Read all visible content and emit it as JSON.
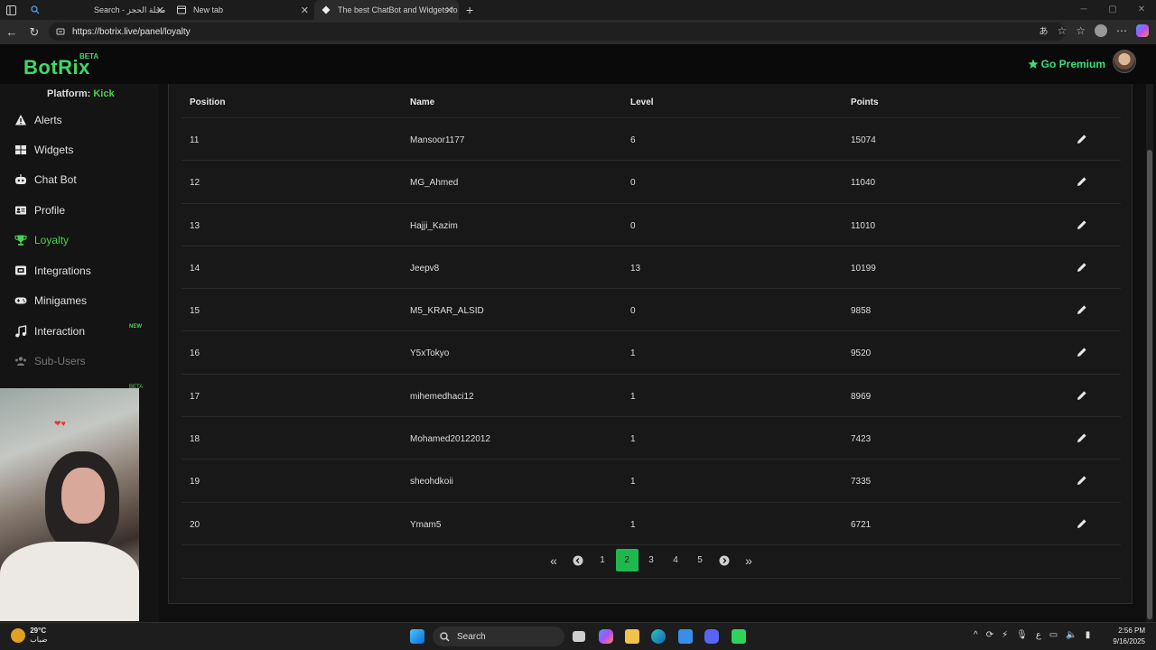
{
  "browser": {
    "tabs": [
      {
        "label": "Search - مجلة الحجز",
        "active": false
      },
      {
        "label": "New tab",
        "active": false
      },
      {
        "label": "The best ChatBot and Widgets fo",
        "active": true
      }
    ],
    "url": "https://botrix.live/panel/loyalty"
  },
  "app": {
    "logo": "BotRix",
    "logo_badge": "BETA",
    "premium_label": "Go Premium"
  },
  "sidebar": {
    "platform_label": "Platform:",
    "platform_value": "Kick",
    "items": [
      {
        "label": "Alerts",
        "icon": "warning-icon"
      },
      {
        "label": "Widgets",
        "icon": "grid-icon"
      },
      {
        "label": "Chat Bot",
        "icon": "robot-icon"
      },
      {
        "label": "Profile",
        "icon": "id-card-icon"
      },
      {
        "label": "Loyalty",
        "icon": "trophy-icon",
        "active": true
      },
      {
        "label": "Integrations",
        "icon": "integrations-icon"
      },
      {
        "label": "Minigames",
        "icon": "gamepad-icon"
      },
      {
        "label": "Interaction",
        "icon": "music-icon",
        "badge": "NEW"
      },
      {
        "label": "Sub-Users",
        "icon": "users-icon",
        "muted": true
      }
    ],
    "hidden_badge": "BETA"
  },
  "table": {
    "headers": {
      "position": "Position",
      "name": "Name",
      "level": "Level",
      "points": "Points"
    },
    "rows": [
      {
        "position": "11",
        "name": "Mansoor1177",
        "level": "6",
        "points": "15074"
      },
      {
        "position": "12",
        "name": "MG_Ahmed",
        "level": "0",
        "points": "11040"
      },
      {
        "position": "13",
        "name": "Hajji_Kazim",
        "level": "0",
        "points": "11010"
      },
      {
        "position": "14",
        "name": "Jeepv8",
        "level": "13",
        "points": "10199"
      },
      {
        "position": "15",
        "name": "M5_KRAR_ALSID",
        "level": "0",
        "points": "9858"
      },
      {
        "position": "16",
        "name": "Y5xTokyo",
        "level": "1",
        "points": "9520"
      },
      {
        "position": "17",
        "name": "mihemedhaci12",
        "level": "1",
        "points": "8969"
      },
      {
        "position": "18",
        "name": "Mohamed20122012",
        "level": "1",
        "points": "7423"
      },
      {
        "position": "19",
        "name": "sheohdkoii",
        "level": "1",
        "points": "7335"
      },
      {
        "position": "20",
        "name": "Ymam5",
        "level": "1",
        "points": "6721"
      }
    ]
  },
  "pagination": {
    "first": "«",
    "prev": "‹",
    "pages": [
      "1",
      "2",
      "3",
      "4",
      "5"
    ],
    "current": "2",
    "next": "›",
    "last": "»"
  },
  "taskbar": {
    "temperature": "29°C",
    "weather_text": "ضباب",
    "search_label": "Search",
    "time": "2:56 PM",
    "date": "9/16/2025",
    "lang": "ع"
  },
  "colors": {
    "accent": "#49d24c",
    "active_page": "#1fb84e",
    "premium": "#39e07a"
  }
}
